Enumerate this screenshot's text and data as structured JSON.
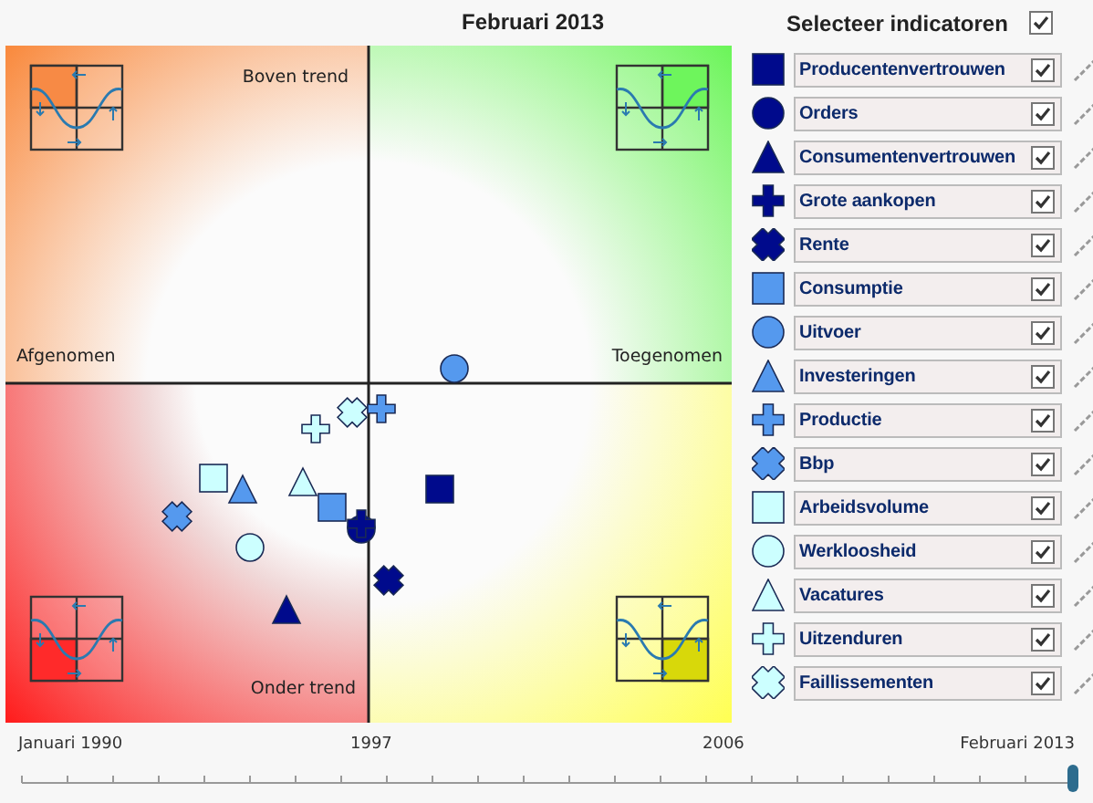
{
  "period": "Februari 2013",
  "select_all": {
    "label": "Selecteer indicatoren",
    "checked": true
  },
  "quadrants": {
    "top_right_label": "Boven trend",
    "left_label": "Afgenomen",
    "right_label": "Toegenomen",
    "bottom_label": "Onder trend"
  },
  "indicators": [
    {
      "label": "Producentenvertrouwen",
      "kind": "square",
      "color": "#000a8c",
      "checked": true
    },
    {
      "label": "Orders",
      "kind": "circle",
      "color": "#000a8c",
      "checked": true
    },
    {
      "label": "Consumentenvertrouwen",
      "kind": "triangle",
      "color": "#000a8c",
      "checked": true
    },
    {
      "label": "Grote aankopen",
      "kind": "plus",
      "color": "#000a8c",
      "checked": true
    },
    {
      "label": "Rente",
      "kind": "cross",
      "color": "#000a8c",
      "checked": true
    },
    {
      "label": "Consumptie",
      "kind": "square",
      "color": "#5599ee",
      "checked": true
    },
    {
      "label": "Uitvoer",
      "kind": "circle",
      "color": "#5599ee",
      "checked": true
    },
    {
      "label": "Investeringen",
      "kind": "triangle",
      "color": "#5599ee",
      "checked": true
    },
    {
      "label": "Productie",
      "kind": "plus",
      "color": "#5599ee",
      "checked": true
    },
    {
      "label": "Bbp",
      "kind": "cross",
      "color": "#5599ee",
      "checked": true
    },
    {
      "label": "Arbeidsvolume",
      "kind": "square",
      "color": "#ccffff",
      "checked": true
    },
    {
      "label": "Werkloosheid",
      "kind": "circle",
      "color": "#ccffff",
      "checked": true
    },
    {
      "label": "Vacatures",
      "kind": "triangle",
      "color": "#ccffff",
      "checked": true
    },
    {
      "label": "Uitzenduren",
      "kind": "plus",
      "color": "#ccffff",
      "checked": true
    },
    {
      "label": "Faillissementen",
      "kind": "cross",
      "color": "#ccffff",
      "checked": true
    }
  ],
  "timeline": {
    "labels": [
      "Januari 1990",
      "1997",
      "2006",
      "Februari 2013"
    ],
    "level": 1.0
  }
}
